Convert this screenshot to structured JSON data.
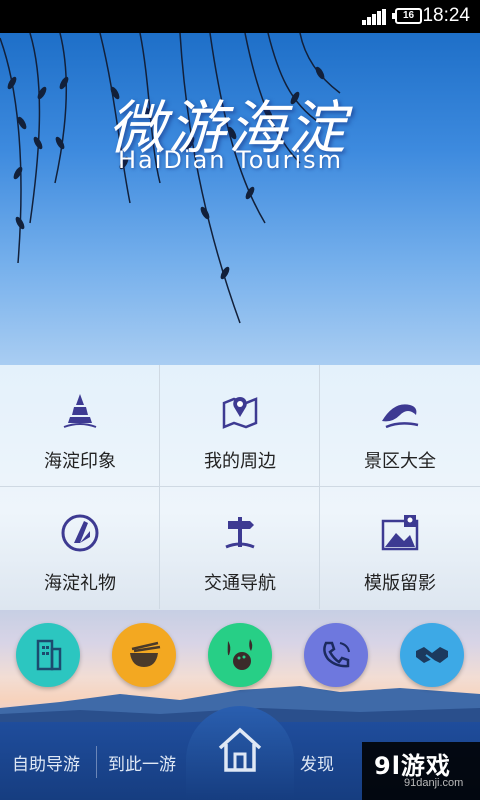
{
  "status_bar": {
    "time": "18:24",
    "battery": "16"
  },
  "hero": {
    "title_cn": "微游海淀",
    "title_en": "HaiDian Tourism"
  },
  "grid": [
    {
      "label": "海淀印象",
      "icon": "pagoda-icon"
    },
    {
      "label": "我的周边",
      "icon": "map-pin-icon"
    },
    {
      "label": "景区大全",
      "icon": "wave-icon"
    },
    {
      "label": "海淀礼物",
      "icon": "gift-logo-icon"
    },
    {
      "label": "交通导航",
      "icon": "signpost-icon"
    },
    {
      "label": "模版留影",
      "icon": "photo-frame-icon"
    }
  ],
  "quick_buttons": [
    {
      "icon": "building-icon",
      "color": "#2cc6c0"
    },
    {
      "icon": "food-bowl-icon",
      "color": "#f3a821"
    },
    {
      "icon": "bowling-icon",
      "color": "#27cf86"
    },
    {
      "icon": "phone-icon",
      "color": "#6e78de"
    },
    {
      "icon": "handshake-icon",
      "color": "#3da9e6"
    }
  ],
  "bottom_nav": {
    "item1": "自助导游",
    "item2": "到此一游",
    "item3": "发现",
    "home_icon": "home-icon"
  },
  "watermark": {
    "title": "9l游戏",
    "site": "91danji.com"
  },
  "colors": {
    "accent": "#3d3a92",
    "nav_bg": "#1f4d9c"
  }
}
